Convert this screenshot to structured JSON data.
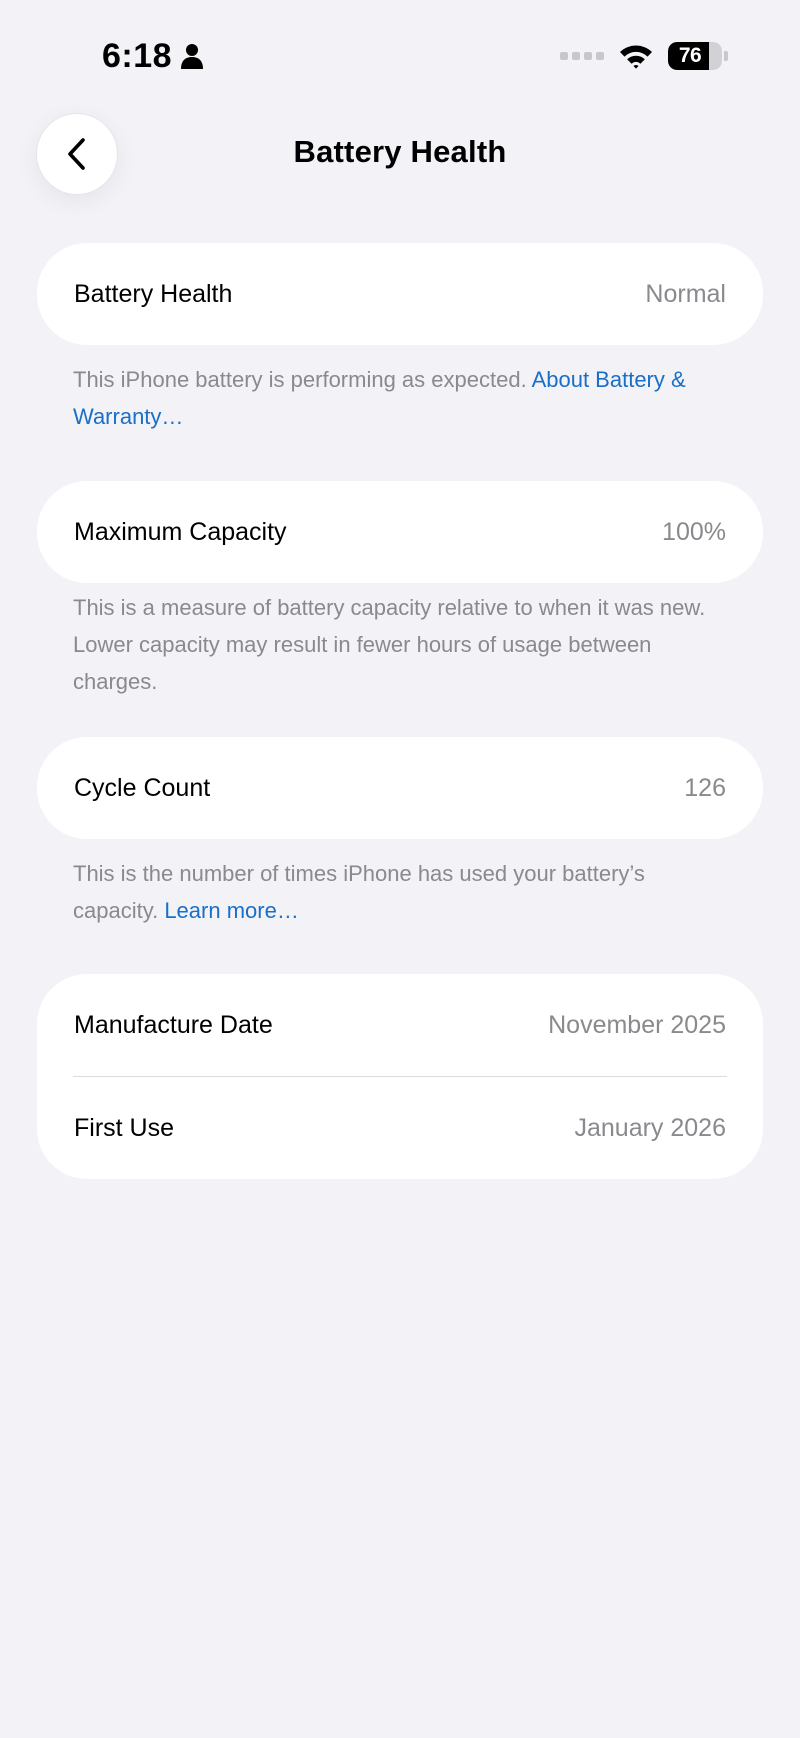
{
  "status_bar": {
    "time": "6:18",
    "battery_level": "76",
    "battery_fraction": 0.76
  },
  "nav": {
    "title": "Battery Health"
  },
  "sections": {
    "battery_health": {
      "label": "Battery Health",
      "value": "Normal",
      "note": "This iPhone battery is performing as expected. ",
      "link": "About Battery & Warranty…"
    },
    "maximum_capacity": {
      "label": "Maximum Capacity",
      "value": "100%",
      "note": "This is a measure of battery capacity relative to when it was new. Lower capacity may result in fewer hours of usage between charges."
    },
    "cycle_count": {
      "label": "Cycle Count",
      "value": "126",
      "note": "This is the number of times iPhone has used your battery’s capacity. ",
      "link": "Learn more…"
    },
    "dates": {
      "manufacture_label": "Manufacture Date",
      "manufacture_value": "November 2025",
      "first_use_label": "First Use",
      "first_use_value": "January 2026"
    }
  },
  "colors": {
    "background": "#f2f2f7",
    "link": "#1a6fc7",
    "secondary_text": "#8a8a8e"
  }
}
